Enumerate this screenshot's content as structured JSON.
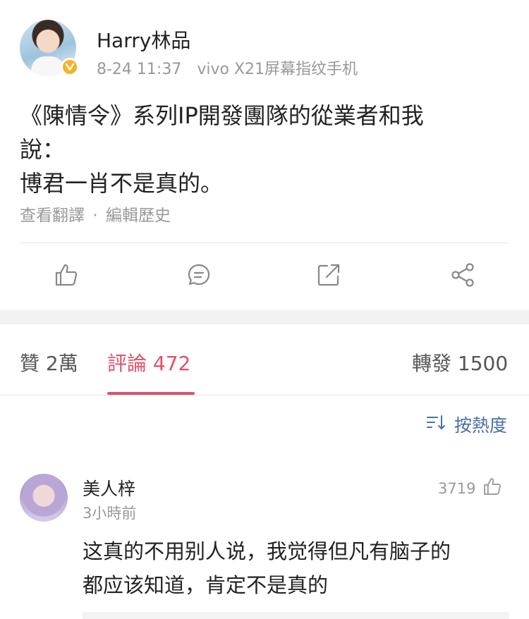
{
  "post": {
    "username": "Harry林品",
    "date": "8-24 11:37",
    "device": "vivo X21屏幕指纹手机",
    "content_lines": [
      "《陳情令》系列IP開發團隊的從業者和我",
      "說：",
      "博君一肖不是真的。"
    ],
    "translate": "查看翻譯",
    "separator": "·",
    "edit_history": "編輯歷史",
    "verified_badge": "v"
  },
  "actions": [
    {
      "name": "like",
      "icon": "thumb-up-icon"
    },
    {
      "name": "comment",
      "icon": "comment-icon"
    },
    {
      "name": "repost",
      "icon": "repost-icon"
    },
    {
      "name": "share",
      "icon": "share-icon"
    }
  ],
  "tabs": {
    "likes": "贊 2萬",
    "comments": "評論 472",
    "reposts": "轉發 1500"
  },
  "sort": {
    "label": "按熱度",
    "icon": "sort-icon"
  },
  "comment": {
    "author": "美人梓",
    "time": "3小時前",
    "likes": "3719",
    "text_lines": [
      "这真的不用别人说，我觉得但凡有脑子的",
      "都应该知道，肯定不是真的"
    ]
  },
  "colors": {
    "accent": "#e0506a",
    "link": "#4a6fa5",
    "muted": "#999999",
    "badge": "#f4b323"
  }
}
